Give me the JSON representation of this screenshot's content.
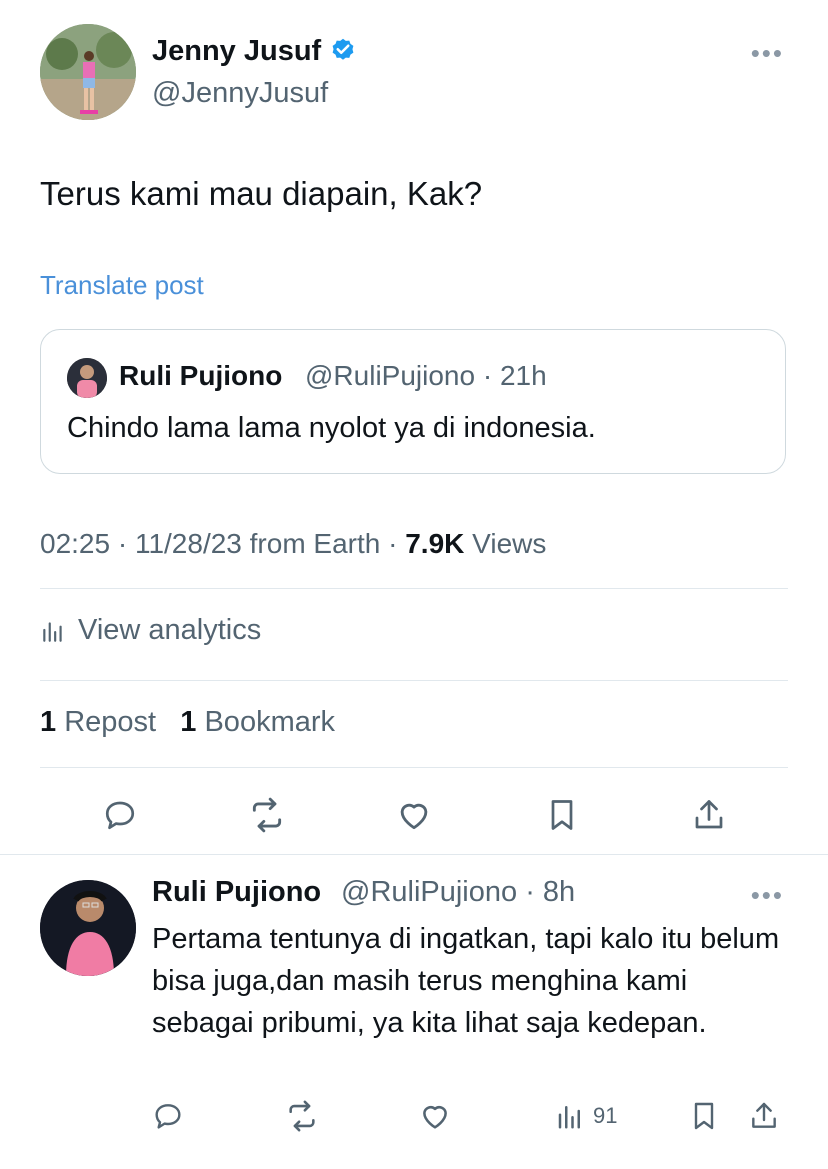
{
  "author": {
    "name": "Jenny Jusuf",
    "handle": "@JennyJusuf",
    "verified": true,
    "verified_color": "#1d9bf0"
  },
  "tweet": {
    "text": "Terus kami mau diapain, Kak?",
    "translate_label": "Translate post"
  },
  "quoted": {
    "name": "Ruli Pujiono",
    "handle": "@RuliPujiono",
    "time": "· 21h",
    "text": "Chindo lama lama nyolot ya di indonesia."
  },
  "meta": {
    "timestamp": "02:25 · 11/28/23 from Earth ·",
    "views_count": "7.9K",
    "views_label": "Views"
  },
  "analytics": {
    "label": "View analytics",
    "icon": "bar-chart-icon"
  },
  "stats": {
    "reposts_count": "1",
    "reposts_label": "Repost",
    "bookmarks_count": "1",
    "bookmarks_label": "Bookmark"
  },
  "reply": {
    "name": "Ruli Pujiono",
    "handle": "@RuliPujiono",
    "time": "· 8h",
    "text": "Pertama tentunya di ingatkan, tapi kalo itu belum bisa juga,dan masih terus menghina kami sebagai pribumi, ya kita lihat saja kedepan.",
    "views": "91"
  },
  "colors": {
    "link": "#4a90d9",
    "muted": "#536471",
    "text": "#0f1419",
    "divider": "#e1e8ed"
  }
}
